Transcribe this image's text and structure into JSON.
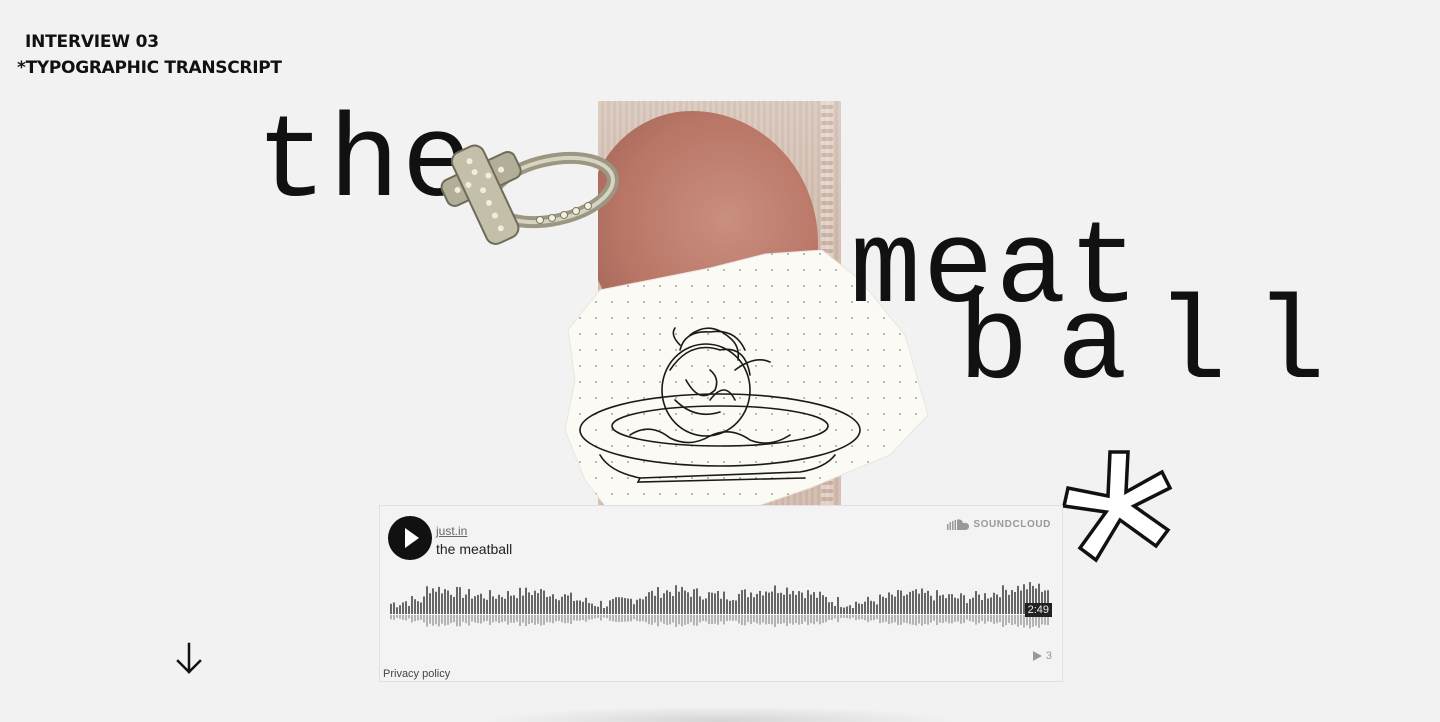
{
  "header": {
    "line1": "INTERVIEW 03",
    "line2": "*TYPOGRAPHIC TRANSCRIPT"
  },
  "hero": {
    "word1": "the",
    "word2": "meat",
    "word3": "ball"
  },
  "player": {
    "username": "just.in",
    "track_title": "the meatball",
    "brand": "SOUNDCLOUD",
    "duration": "2:49",
    "play_count": "3",
    "privacy_label": "Privacy policy",
    "progress": 0
  },
  "icons": {
    "play": "play-icon",
    "soundcloud": "soundcloud-cloud-icon",
    "plays": "play-count-icon",
    "down_arrow": "arrow-down-icon",
    "asterisk": "asterisk-icon"
  },
  "colors": {
    "background": "#f2f2f2",
    "text": "#111111",
    "wave": "#666666",
    "widget_bg": "#f3f3f3"
  }
}
